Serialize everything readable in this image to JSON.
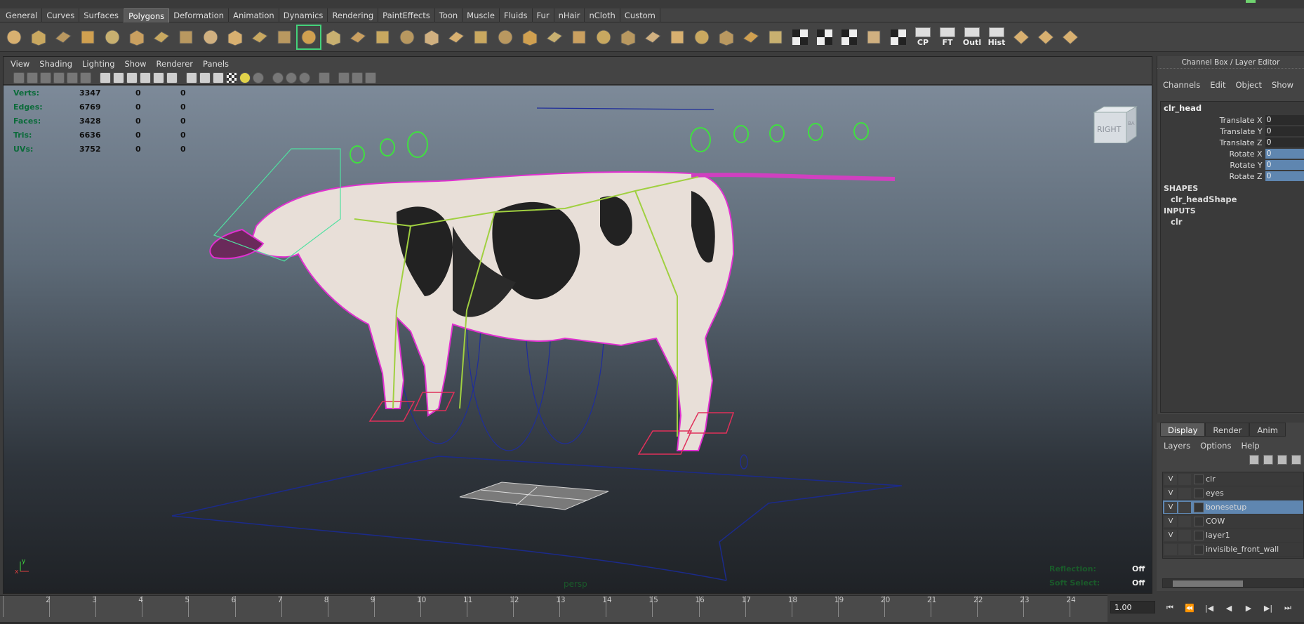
{
  "shelf_tabs": [
    {
      "label": "General"
    },
    {
      "label": "Curves"
    },
    {
      "label": "Surfaces"
    },
    {
      "label": "Polygons"
    },
    {
      "label": "Deformation"
    },
    {
      "label": "Animation"
    },
    {
      "label": "Dynamics"
    },
    {
      "label": "Rendering"
    },
    {
      "label": "PaintEffects"
    },
    {
      "label": "Toon"
    },
    {
      "label": "Muscle"
    },
    {
      "label": "Fluids"
    },
    {
      "label": "Fur"
    },
    {
      "label": "nHair"
    },
    {
      "label": "nCloth"
    },
    {
      "label": "Custom"
    }
  ],
  "shelf_active_tab": "Polygons",
  "shelf_text_tools": {
    "cp": "CP",
    "ft": "FT",
    "outl": "Outl",
    "hist": "Hist"
  },
  "viewport": {
    "menu": [
      "View",
      "Shading",
      "Lighting",
      "Show",
      "Renderer",
      "Panels"
    ],
    "hud": [
      {
        "label": "Verts:",
        "v1": "3347",
        "v2": "0",
        "v3": "0"
      },
      {
        "label": "Edges:",
        "v1": "6769",
        "v2": "0",
        "v3": "0"
      },
      {
        "label": "Faces:",
        "v1": "3428",
        "v2": "0",
        "v3": "0"
      },
      {
        "label": "Tris:",
        "v1": "6636",
        "v2": "0",
        "v3": "0"
      },
      {
        "label": "UVs:",
        "v1": "3752",
        "v2": "0",
        "v3": "0"
      }
    ],
    "view_cube": {
      "front": "RIGHT",
      "side": "BA"
    },
    "camera": "persp",
    "axis_y": "y",
    "axis_x": "x",
    "reflection_label": "Reflection:",
    "reflection_value": "Off",
    "soft_select_label": "Soft Select:",
    "soft_select_value": "Off"
  },
  "channel_box": {
    "title": "Channel Box / Layer Editor",
    "menu": [
      "Channels",
      "Edit",
      "Object",
      "Show"
    ],
    "object": "clr_head",
    "attributes": [
      {
        "name": "Translate X",
        "value": "0"
      },
      {
        "name": "Translate Y",
        "value": "0"
      },
      {
        "name": "Translate Z",
        "value": "0"
      },
      {
        "name": "Rotate X",
        "value": "0"
      },
      {
        "name": "Rotate Y",
        "value": "0"
      },
      {
        "name": "Rotate Z",
        "value": "0"
      }
    ],
    "shapes_label": "SHAPES",
    "shape": "clr_headShape",
    "inputs_label": "INPUTS",
    "input": "clr"
  },
  "layer_editor": {
    "tabs": [
      "Display",
      "Render",
      "Anim"
    ],
    "menu": [
      "Layers",
      "Options",
      "Help"
    ],
    "layers": [
      {
        "vis": "V",
        "name": "clr"
      },
      {
        "vis": "V",
        "name": "eyes"
      },
      {
        "vis": "V",
        "name": "bonesetup"
      },
      {
        "vis": "V",
        "name": "COW"
      },
      {
        "vis": "V",
        "name": "layer1"
      },
      {
        "vis": "",
        "name": "invisible_front_wall"
      }
    ],
    "selected_layer": "bonesetup"
  },
  "time_slider": {
    "frames": [
      "2",
      "3",
      "4",
      "5",
      "6",
      "7",
      "8",
      "9",
      "10",
      "11",
      "12",
      "13",
      "14",
      "15",
      "16",
      "17",
      "18",
      "19",
      "20",
      "21",
      "22",
      "23",
      "24"
    ],
    "current_frame": "1.00"
  }
}
